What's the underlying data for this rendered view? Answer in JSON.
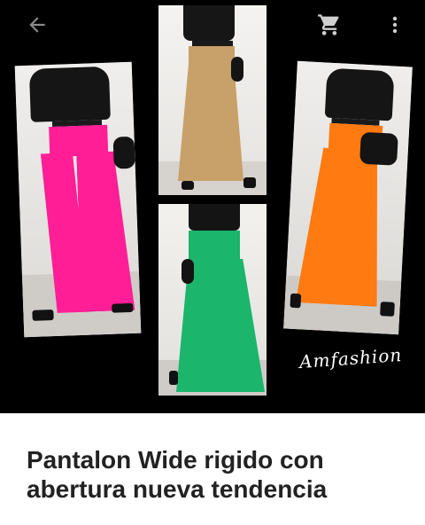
{
  "toolbar": {
    "back_icon": "arrow-left-icon",
    "cart_icon": "shopping-cart-icon",
    "menu_icon": "more-vertical-icon"
  },
  "hero": {
    "signature": "Amfashion"
  },
  "product": {
    "title": "Pantalon Wide rigido con abertura nueva tendencia"
  },
  "colors": {
    "pink": "#ff1e96",
    "tan": "#c8a06a",
    "green": "#1bb56c",
    "orange": "#ff7a10"
  }
}
